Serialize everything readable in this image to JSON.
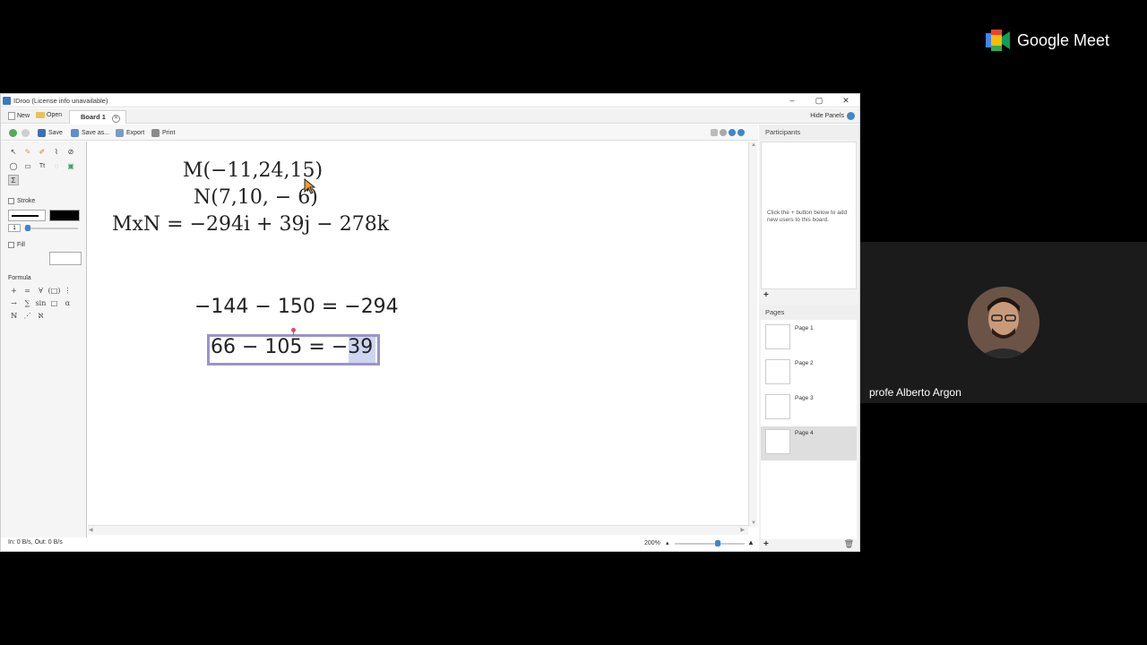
{
  "meet": {
    "brand": "Google Meet",
    "participant_name": "profe Alberto Argon"
  },
  "window": {
    "title": "IDroo (License info unavailable)",
    "controls": [
      "–",
      "▢",
      "✕"
    ]
  },
  "tabs": {
    "new_label": "New",
    "open_label": "Open",
    "board_tab": "Board 1",
    "hide_panels": "Hide Panels"
  },
  "toolbar": {
    "save": "Save",
    "save_as": "Save as...",
    "export": "Export",
    "print": "Print"
  },
  "tool_panel": {
    "stroke_label": "Stroke",
    "stroke_width": "1",
    "fill_label": "Fill",
    "formula_label": "Formula",
    "formula_buttons": [
      "+",
      "=",
      "∀",
      "(□)",
      "⋮",
      "→",
      "∑",
      "sin",
      "□",
      "α",
      "ℕ",
      "⋰",
      "ℵ"
    ]
  },
  "canvas": {
    "line1": "M(−11,24,15)",
    "line2": "N(7,10, − 6)",
    "line3": "MxN = −294i + 39j − 278k",
    "line4": "−144 − 150 = −294",
    "line5_prefix": "66 − 105 = −",
    "line5_selected": "39"
  },
  "status": {
    "traffic": "In: 0 B/s, Out: 0 B/s",
    "zoom": "200%"
  },
  "participants_panel": {
    "header": "Participants",
    "hint": "Click the + button below to add new users to this board."
  },
  "pages_panel": {
    "header": "Pages",
    "pages": [
      {
        "label": "Page 1"
      },
      {
        "label": "Page 2"
      },
      {
        "label": "Page 3"
      },
      {
        "label": "Page 4"
      }
    ],
    "active_page": "Page 4"
  },
  "colors": {
    "accent": "#3d87cf",
    "selection_border": "#9a94c8",
    "selection_fill": "#cdd6ef"
  }
}
